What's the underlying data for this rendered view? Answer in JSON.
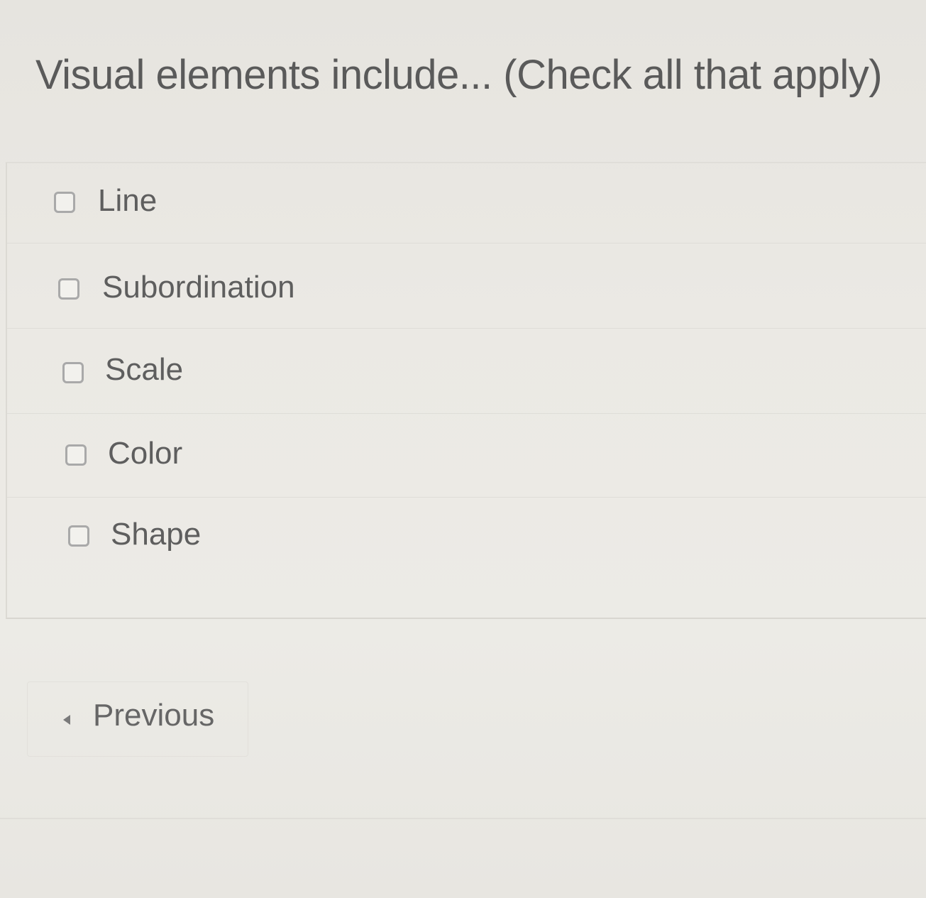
{
  "question": {
    "title": "Visual elements include... (Check all that apply)"
  },
  "answers": [
    {
      "label": "Line",
      "checked": false
    },
    {
      "label": "Subordination",
      "checked": false
    },
    {
      "label": "Scale",
      "checked": false
    },
    {
      "label": "Color",
      "checked": false
    },
    {
      "label": "Shape",
      "checked": false
    }
  ],
  "navigation": {
    "previous_label": "Previous",
    "previous_icon": "triangle-left-icon"
  }
}
